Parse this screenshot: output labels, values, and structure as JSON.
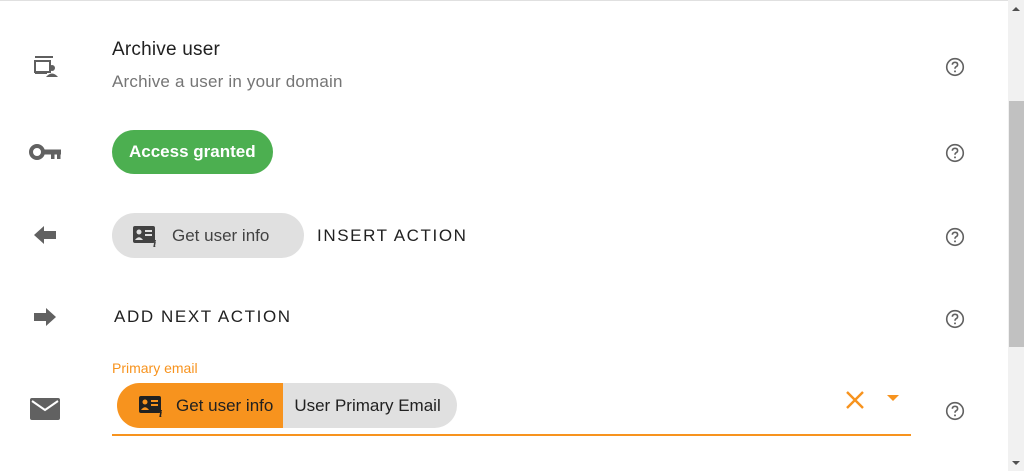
{
  "archive": {
    "title": "Archive user",
    "subtitle": "Archive a user in your domain",
    "icon": "user-card-icon"
  },
  "access": {
    "label": "Access granted",
    "color": "#4caf50",
    "icon": "key-icon"
  },
  "previous": {
    "chip_label": "Get user info",
    "insert_label": "INSERT ACTION",
    "icon": "arrow-left-icon"
  },
  "next": {
    "add_label": "ADD NEXT ACTION",
    "icon": "arrow-right-icon"
  },
  "email": {
    "label": "Primary email",
    "token_source": "Get user info",
    "token_value": "User Primary Email",
    "accent_color": "#f7931e",
    "icon": "mail-icon"
  }
}
